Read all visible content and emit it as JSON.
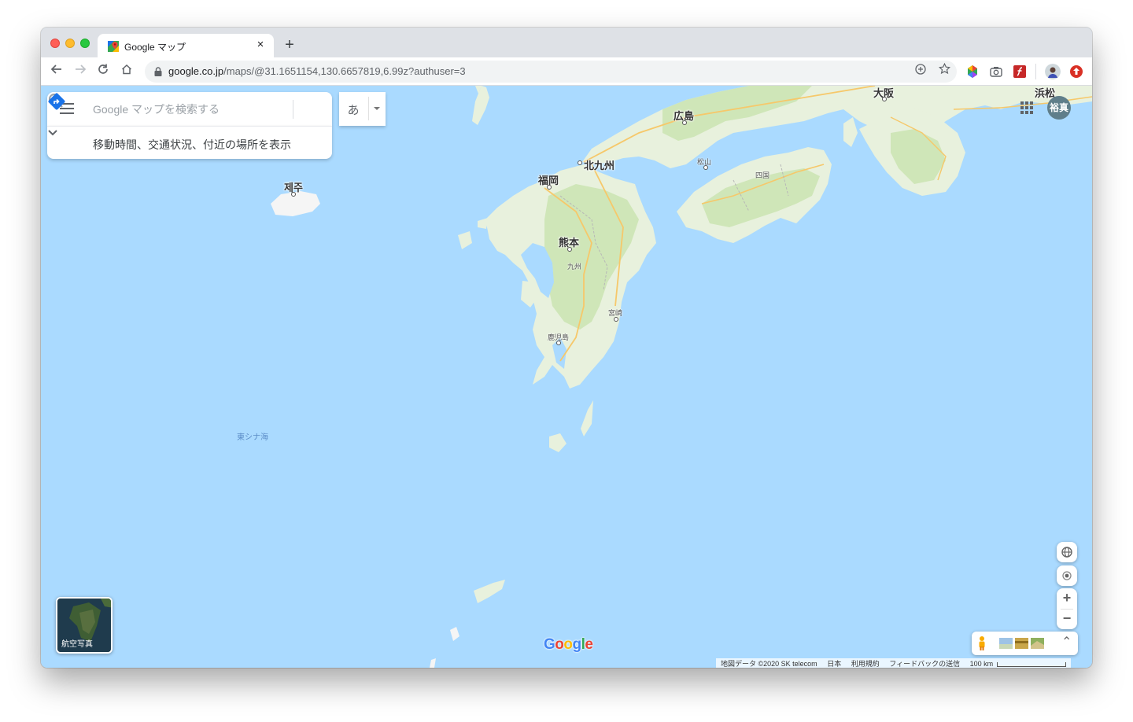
{
  "browser": {
    "tab_title": "Google マップ",
    "tab_close": "×",
    "new_tab": "+",
    "url_host": "google.co.jp",
    "url_path": "/maps/@31.1651154,130.6657819,6.99z?authuser=3"
  },
  "search": {
    "placeholder": "Google マップを検索する",
    "value": "",
    "ime_char": "あ",
    "subtext": "移動時間、交通状況、付近の場所を表示"
  },
  "account": {
    "name": "裕真"
  },
  "map": {
    "labels": {
      "osaka": "大阪",
      "hamamatsu": "浜松",
      "hiroshima": "広島",
      "kitakyushu": "北九州",
      "fukuoka": "福岡",
      "jeju": "제주",
      "kumamoto": "熊本",
      "kyushu": "九州",
      "matsuyama": "松山",
      "shikoku": "四国",
      "miyazaki": "宮崎",
      "kagoshima": "鹿児島",
      "east_china_sea": "東シナ海"
    }
  },
  "layers": {
    "label": "航空写真"
  },
  "logo": {
    "g": "G",
    "o1": "o",
    "o2": "o",
    "g2": "g",
    "l": "l",
    "e": "e"
  },
  "footer": {
    "map_data": "地図データ ©2020 SK telecom",
    "country": "日本",
    "terms": "利用規約",
    "feedback": "フィードバックの送信",
    "scale": "100 km"
  },
  "controls": {
    "zoom_in": "+",
    "zoom_out": "−",
    "expand": "⌃"
  },
  "colors": {
    "water": "#aadaff",
    "land": "#e8f1dd",
    "land_green": "#cfe6b8",
    "road": "#f6c86a",
    "accent_blue": "#4285f4"
  }
}
